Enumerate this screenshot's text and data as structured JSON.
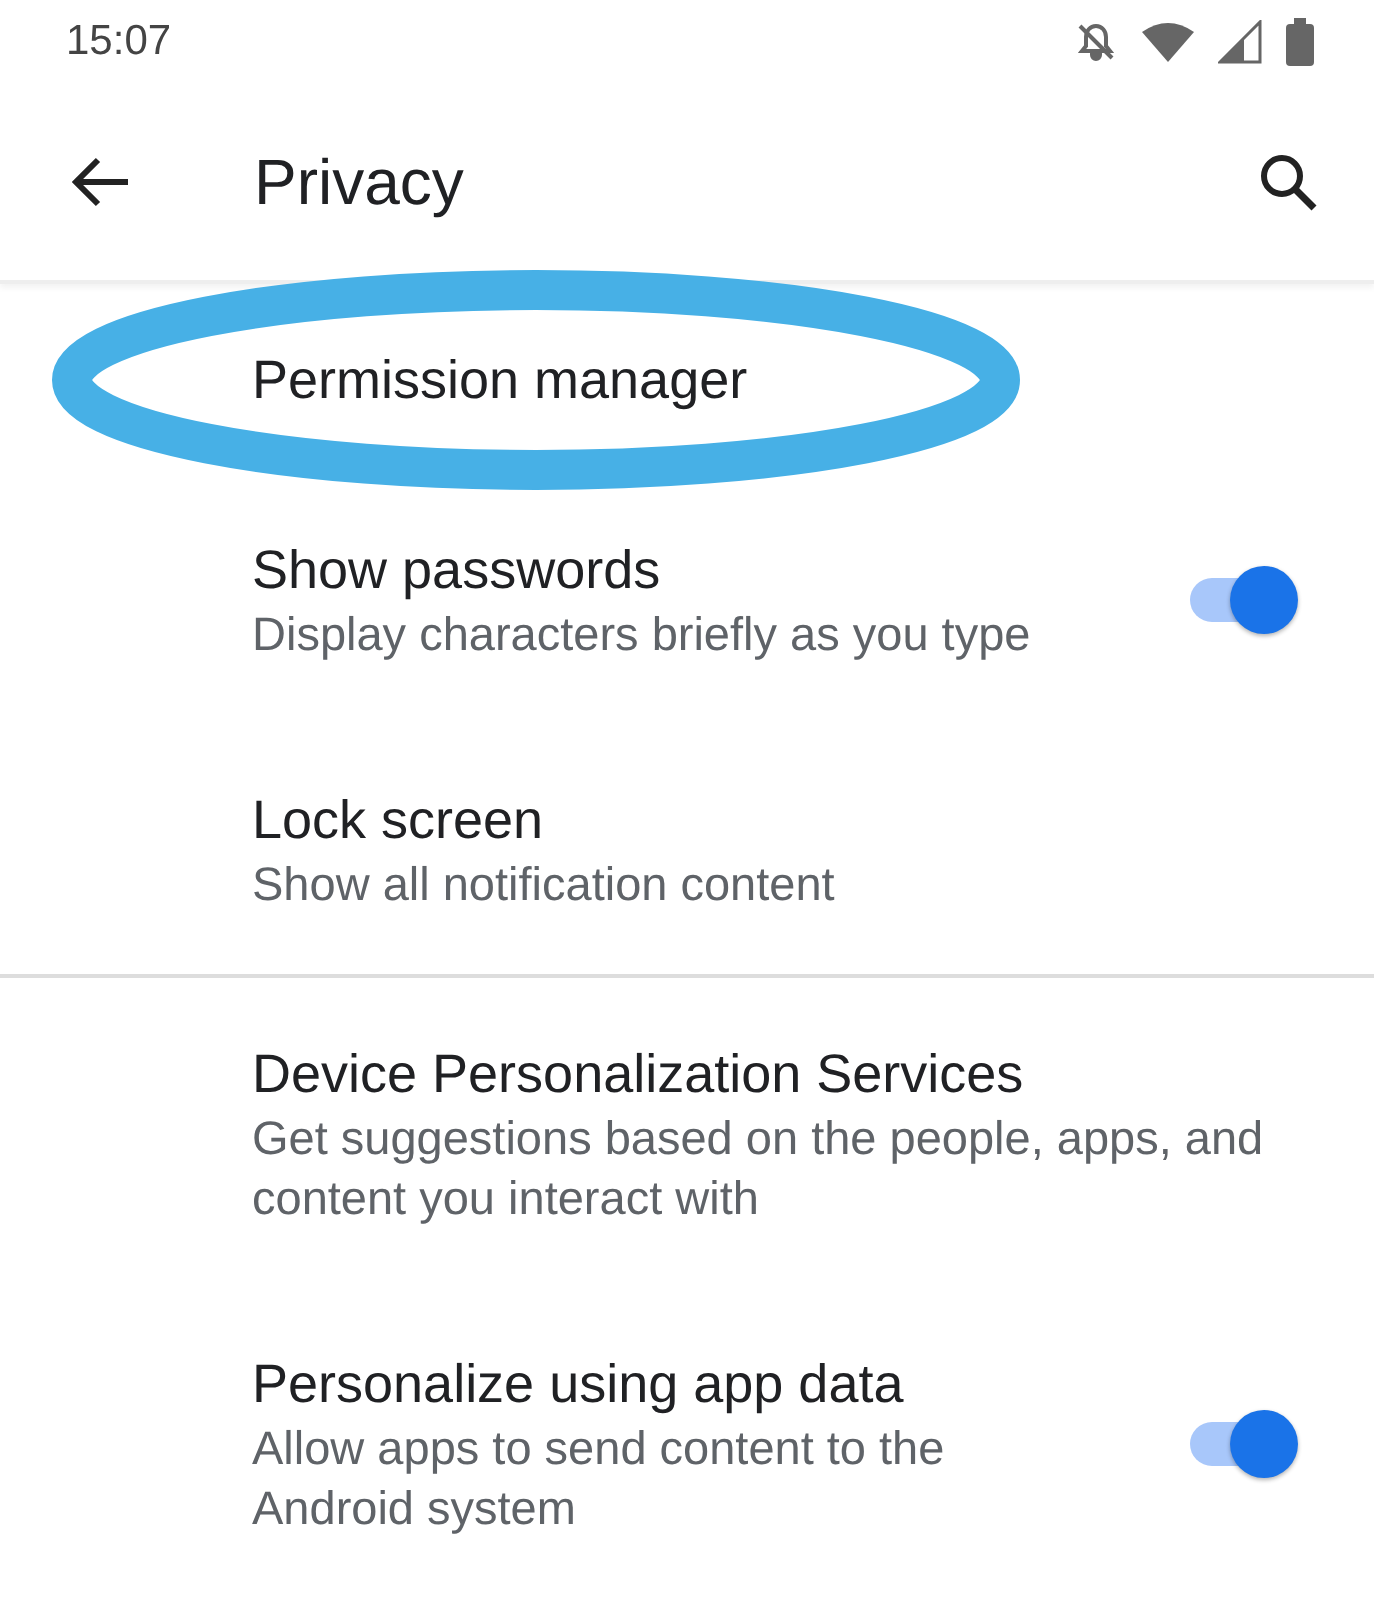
{
  "status_bar": {
    "time": "15:07"
  },
  "app_bar": {
    "title": "Privacy"
  },
  "items": [
    {
      "kind": "text",
      "title": "Permission manager",
      "circled": true
    },
    {
      "kind": "switch",
      "title": "Show passwords",
      "summary": "Display characters briefly as you type",
      "on": true
    },
    {
      "kind": "text",
      "title": "Lock screen",
      "summary": "Show all notification content",
      "divider_after": true
    },
    {
      "kind": "text",
      "title": "Device Personalization Services",
      "summary": "Get suggestions based on the people, apps, and content you interact with"
    },
    {
      "kind": "switch",
      "title": "Personalize using app data",
      "summary": "Allow apps to send content to the Android system",
      "on": true
    }
  ]
}
